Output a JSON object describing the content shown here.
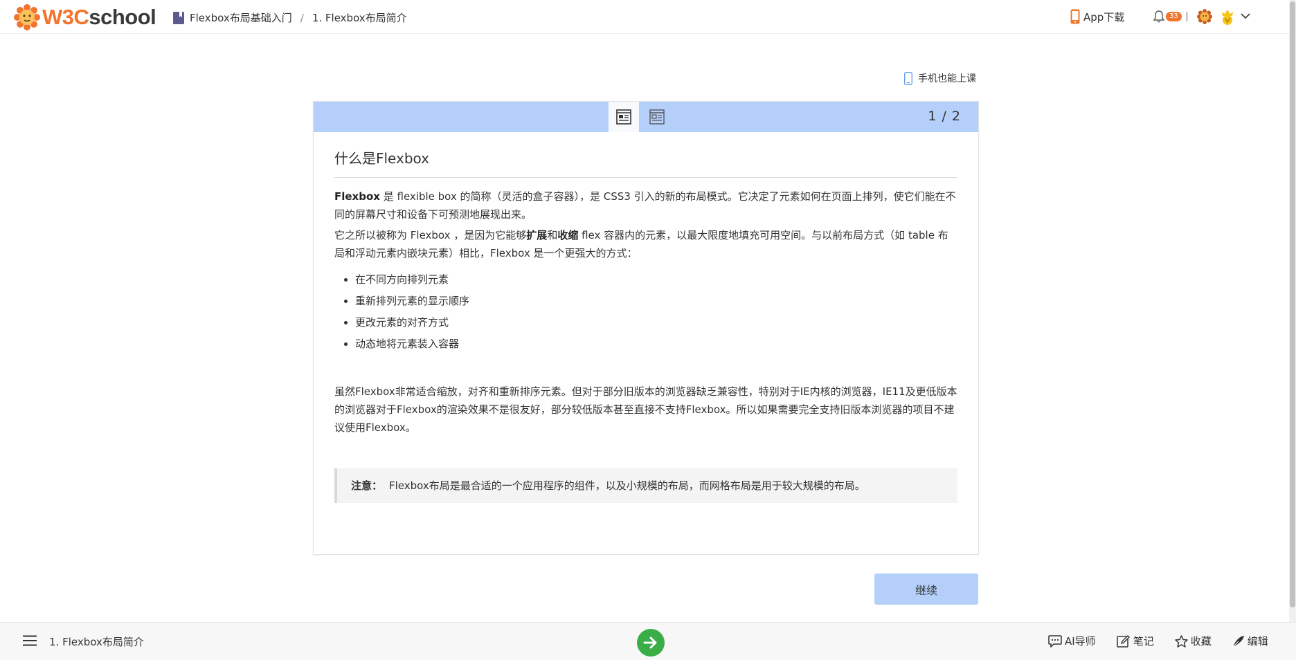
{
  "header": {
    "logo_text_w3c": "W3C",
    "logo_text_school": "school",
    "breadcrumb_course": "Flexbox布局基础入门",
    "breadcrumb_sep": "/",
    "breadcrumb_lesson": "1. Flexbox布局简介",
    "app_download": "App下载",
    "notification_count": "33",
    "brand_color": "#f2742d"
  },
  "mobile_link": "手机也能上课",
  "card": {
    "pager": "1 / 2",
    "header_color": "#b3cffa",
    "tabs": [
      {
        "icon": "article-icon",
        "active": true
      },
      {
        "icon": "document-icon",
        "active": false
      }
    ],
    "title": "什么是Flexbox",
    "p1_b1": "Flexbox",
    "p1_t1": " 是 flexible box 的简称（灵活的盒子容器），是 CSS3 引入的新的布局模式。它决定了元素如何在页面上排列，使它们能在不同的屏幕尺寸和设备下可预测地展现出来。",
    "p2_t1": "它之所以被称为 Flexbox ，是因为它能够",
    "p2_b1": "扩展",
    "p2_t2": "和",
    "p2_b2": "收缩",
    "p2_t3": " flex 容器内的元素，以最大限度地填充可用空间。与以前布局方式（如 table 布局和浮动元素内嵌块元素）相比，Flexbox 是一个更强大的方式：",
    "features": [
      "在不同方向排列元素",
      "重新排列元素的显示顺序",
      "更改元素的对齐方式",
      "动态地将元素装入容器"
    ],
    "p3": "虽然Flexbox非常适合缩放，对齐和重新排序元素。但对于部分旧版本的浏览器缺乏兼容性，特别对于IE内核的浏览器，IE11及更低版本的浏览器对于Flexbox的渲染效果不是很友好，部分较低版本甚至直接不支持Flexbox。所以如果需要完全支持旧版本浏览器的项目不建议使用Flexbox。",
    "note_label": "注意：",
    "note_text": "Flexbox布局是最合适的一个应用程序的组件，以及小规模的布局，而网格布局是用于较大规模的布局。"
  },
  "continue_label": "继续",
  "bottom": {
    "lesson_title": "1. Flexbox布局简介",
    "go_color": "#3aad47",
    "tools": [
      {
        "label": "AI导师",
        "icon": "chat-icon"
      },
      {
        "label": "笔记",
        "icon": "note-icon"
      },
      {
        "label": "收藏",
        "icon": "star-icon"
      },
      {
        "label": "编辑",
        "icon": "pen-icon"
      }
    ]
  }
}
